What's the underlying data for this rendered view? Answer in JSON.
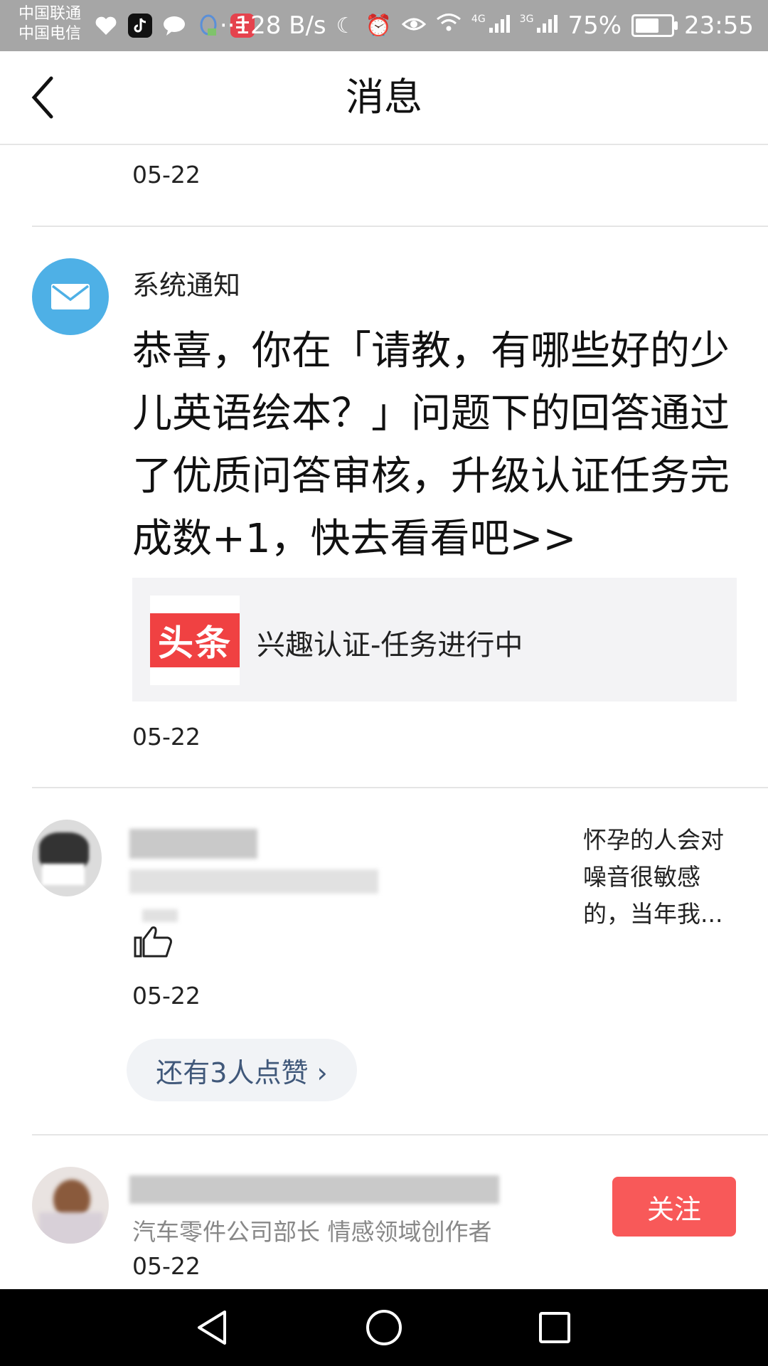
{
  "status_bar": {
    "carrier_1": "中国联通",
    "carrier_2": "中国电信",
    "net_speed": "··128 B/s",
    "signal_4g": "4G",
    "signal_3g": "3G",
    "battery": "75%",
    "battery_level": 0.75,
    "time": "23:55"
  },
  "header": {
    "title": "消息"
  },
  "messages": [
    {
      "date": "05-22"
    },
    {
      "sender": "系统通知",
      "text": "恭喜，你在「请教，有哪些好的少儿英语绘本？」问题下的回答通过了优质问答审核，升级认证任务完成数+1，快去看看吧>>",
      "card": {
        "logo_text": "头条",
        "label": "兴趣认证-任务进行中"
      },
      "date": "05-22"
    },
    {
      "quote": "怀孕的人会对噪音很敏感的，当年我...",
      "date": "05-22",
      "more_likes": "还有3人点赞 ›"
    },
    {
      "description": "汽车零件公司部长 情感领域创作者",
      "follow_label": "关注",
      "date": "05-22"
    }
  ],
  "colors": {
    "status_bar": "#a6a6a6",
    "mail_avatar": "#4eb0e6",
    "toutiao_red": "#f04142",
    "follow_button": "#f85959",
    "more_likes_text": "#40587a"
  },
  "icons": [
    "back-arrow-icon",
    "mail-icon",
    "thumbs-up-icon",
    "nav-back-icon",
    "nav-home-icon",
    "nav-recents-icon"
  ]
}
